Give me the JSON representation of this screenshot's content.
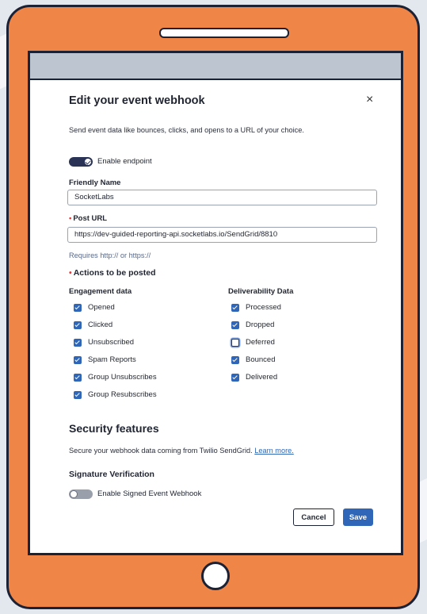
{
  "modal": {
    "title": "Edit your event webhook",
    "close_icon": "×",
    "description": "Send event data like bounces, clicks, and opens to a URL of your choice.",
    "enable_endpoint": {
      "label": "Enable endpoint",
      "enabled": true
    },
    "friendly_name": {
      "label": "Friendly Name",
      "value": "SocketLabs"
    },
    "post_url": {
      "required_marker": "•",
      "label": "Post URL",
      "value": "https://dev-guided-reporting-api.socketlabs.io/SendGrid/8810",
      "helper": "Requires http:// or https://"
    },
    "actions": {
      "required_marker": "•",
      "label": "Actions to be posted",
      "engagement": {
        "header": "Engagement data",
        "items": [
          {
            "label": "Opened",
            "checked": true
          },
          {
            "label": "Clicked",
            "checked": true
          },
          {
            "label": "Unsubscribed",
            "checked": true
          },
          {
            "label": "Spam Reports",
            "checked": true
          },
          {
            "label": "Group Unsubscribes",
            "checked": true
          },
          {
            "label": "Group Resubscribes",
            "checked": true
          }
        ]
      },
      "deliverability": {
        "header": "Deliverability Data",
        "items": [
          {
            "label": "Processed",
            "checked": true
          },
          {
            "label": "Dropped",
            "checked": true
          },
          {
            "label": "Deferred",
            "checked": false
          },
          {
            "label": "Bounced",
            "checked": true
          },
          {
            "label": "Delivered",
            "checked": true
          }
        ]
      }
    },
    "security": {
      "title": "Security features",
      "description": "Secure your webhook data coming from Twilio SendGrid.",
      "learn_more": "Learn more.",
      "signature_title": "Signature Verification",
      "signed_webhook": {
        "label": "Enable Signed Event Webhook",
        "enabled": false
      }
    },
    "buttons": {
      "cancel": "Cancel",
      "save": "Save"
    }
  },
  "colors": {
    "tablet": "#ef8547",
    "accent": "#2f66b7",
    "toggle_on": "#2a3356",
    "required": "#e03a3a"
  }
}
